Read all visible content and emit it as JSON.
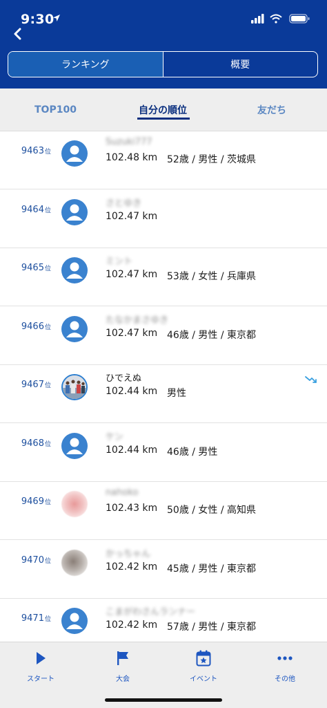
{
  "status_bar": {
    "time": "9:30"
  },
  "segmented": {
    "left_label": "ランキング",
    "right_label": "概要",
    "active": "left"
  },
  "subtabs": {
    "top100": "TOP100",
    "mine": "自分の順位",
    "friends": "友だち",
    "active": "mine"
  },
  "rows": [
    {
      "rank": "9463",
      "rank_suffix": "位",
      "name": "Suzuki777",
      "name_blurred": true,
      "distance": "102.48 km",
      "info": "52歳 / 男性 / 茨城県",
      "avatar": "default"
    },
    {
      "rank": "9464",
      "rank_suffix": "位",
      "name": "さとゆき",
      "name_blurred": true,
      "distance": "102.47 km",
      "info": "",
      "avatar": "default"
    },
    {
      "rank": "9465",
      "rank_suffix": "位",
      "name": "ミント",
      "name_blurred": true,
      "distance": "102.47 km",
      "info": "53歳 / 女性 / 兵庫県",
      "avatar": "default"
    },
    {
      "rank": "9466",
      "rank_suffix": "位",
      "name": "たなかまさゆき",
      "name_blurred": true,
      "distance": "102.47 km",
      "info": "46歳 / 男性 / 東京都",
      "avatar": "default"
    },
    {
      "rank": "9467",
      "rank_suffix": "位",
      "name": "ひでえぬ",
      "name_blurred": false,
      "distance": "102.44 km",
      "info": "男性",
      "avatar": "photo",
      "trend": true
    },
    {
      "rank": "9468",
      "rank_suffix": "位",
      "name": "ケン",
      "name_blurred": true,
      "distance": "102.44 km",
      "info": "46歳 / 男性",
      "avatar": "default"
    },
    {
      "rank": "9469",
      "rank_suffix": "位",
      "name": "nahoko",
      "name_blurred": true,
      "distance": "102.43 km",
      "info": "50歳 / 女性 / 高知県",
      "avatar": "pink"
    },
    {
      "rank": "9470",
      "rank_suffix": "位",
      "name": "かっちゃん",
      "name_blurred": true,
      "distance": "102.42 km",
      "info": "45歳 / 男性 / 東京都",
      "avatar": "blurred"
    },
    {
      "rank": "9471",
      "rank_suffix": "位",
      "name": "こまがわさんランナー",
      "name_blurred": true,
      "distance": "102.42 km",
      "info": "57歳 / 男性 / 東京都",
      "avatar": "default"
    }
  ],
  "tabbar": {
    "start": "スタート",
    "race": "大会",
    "event": "イベント",
    "other": "その他",
    "active": "event"
  },
  "colors": {
    "header": "#0a3a99",
    "accent": "#1d56c0",
    "rank_text": "#1d4f9e",
    "avatar_default": "#3a82cf"
  }
}
